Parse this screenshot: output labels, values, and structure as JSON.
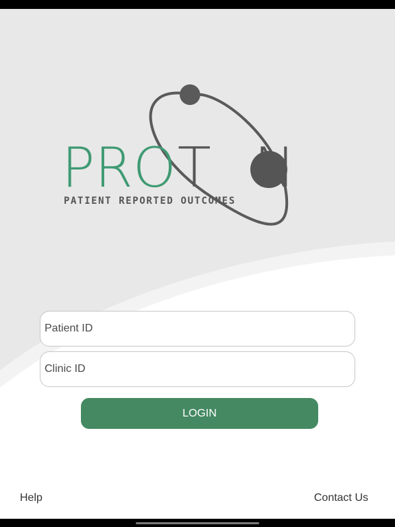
{
  "app": {
    "name": "Proton"
  },
  "logo": {
    "wordmark": [
      "P",
      "R",
      "O",
      "T",
      "O",
      "N"
    ],
    "tagline": "PATIENT REPORTED OUTCOMES",
    "colors": {
      "accent_green": "#3f9a73",
      "dark_gray": "#555555",
      "orbit_gray": "#5a5a5a"
    }
  },
  "form": {
    "patient_id": {
      "placeholder": "Patient ID",
      "value": ""
    },
    "clinic_id": {
      "placeholder": "Clinic ID",
      "value": ""
    },
    "login_label": "LOGIN"
  },
  "footer": {
    "help_label": "Help",
    "contact_label": "Contact Us"
  },
  "theme": {
    "primary_button": "#448962",
    "background_gray": "#e8e8e8",
    "background_white": "#ffffff"
  }
}
